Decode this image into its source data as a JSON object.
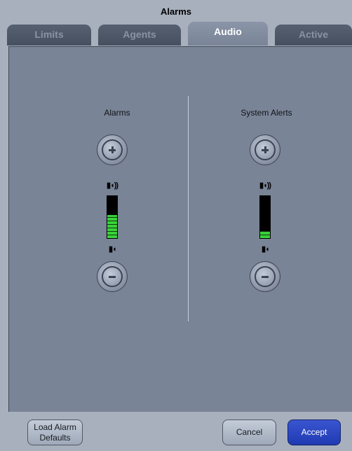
{
  "window": {
    "title": "Alarms"
  },
  "tabs": [
    {
      "label": "Limits"
    },
    {
      "label": "Agents"
    },
    {
      "label": "Audio",
      "active": true
    },
    {
      "label": "Active"
    }
  ],
  "audio": {
    "alarms": {
      "title": "Alarms",
      "volume_level_fraction": 0.55
    },
    "system_alerts": {
      "title": "System Alerts",
      "volume_level_fraction": 0.17
    },
    "speaker_loud_symbol": "▮◖))",
    "speaker_quiet_symbol": "▮◖"
  },
  "footer": {
    "load_defaults_label": "Load Alarm Defaults",
    "cancel_label": "Cancel",
    "accept_label": "Accept"
  },
  "colors": {
    "meter_green": "#39d23a",
    "accept_blue": "#1f3ab2"
  }
}
